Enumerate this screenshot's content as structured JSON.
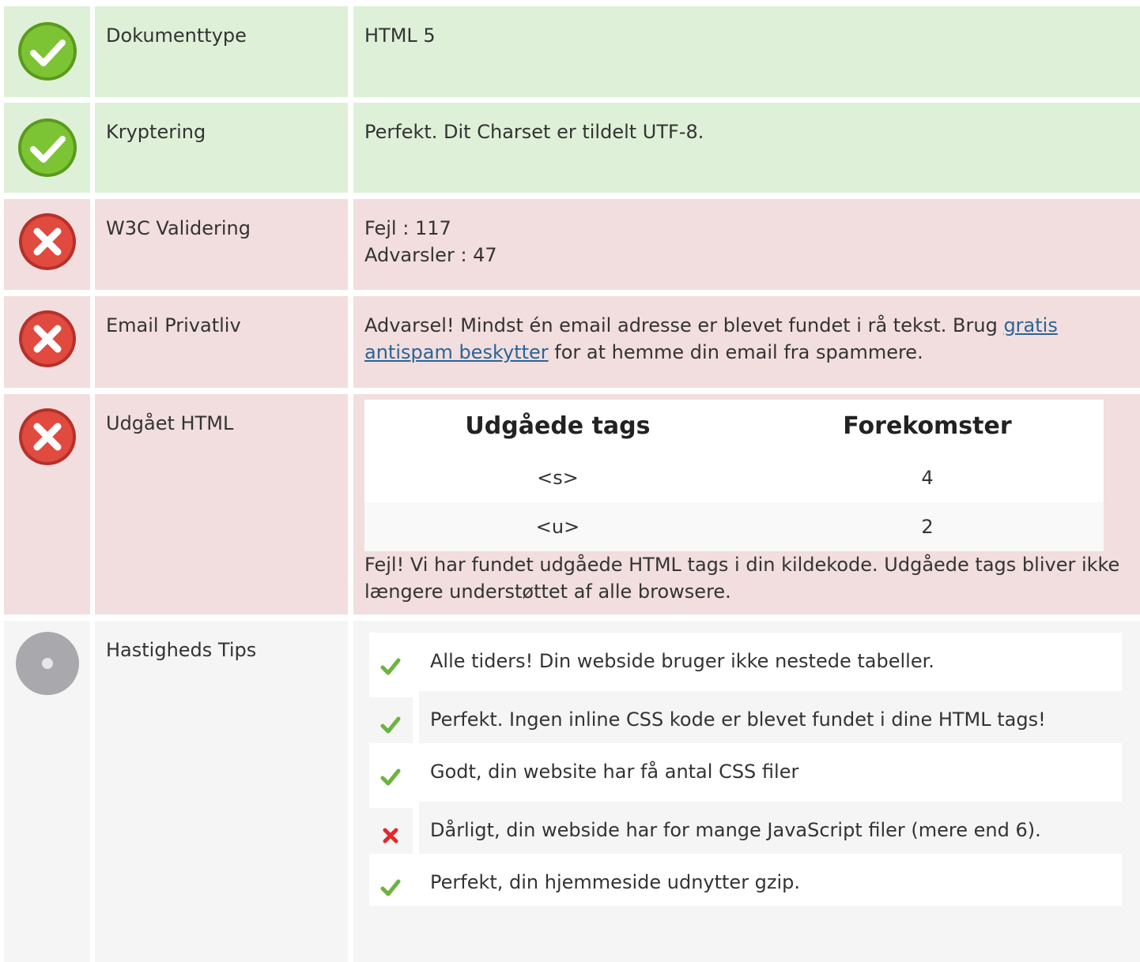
{
  "colors": {
    "ok_bg": "#dff0d8",
    "bad_bg": "#f2dede",
    "neutral_bg": "#f5f5f5",
    "ok_icon": "#6cb12a",
    "bad_icon": "#d9443a",
    "link": "#2a6496",
    "tip_pass": "#6db33f",
    "tip_fail": "#e2292a"
  },
  "rows": {
    "doctype": {
      "status": "pass",
      "icon": "check-circle-icon",
      "label": "Dokumenttype",
      "value": "HTML 5"
    },
    "encoding": {
      "status": "pass",
      "icon": "check-circle-icon",
      "label": "Kryptering",
      "value": "Perfekt. Dit Charset er tildelt UTF-8."
    },
    "w3c": {
      "status": "fail",
      "icon": "cross-circle-icon",
      "label": "W3C Validering",
      "errors_line": "Fejl : 117",
      "warnings_line": "Advarsler : 47"
    },
    "email": {
      "status": "fail",
      "icon": "cross-circle-icon",
      "label": "Email Privatliv",
      "text_before": "Advarsel! Mindst én email adresse er blevet fundet i rå tekst. Brug ",
      "link_text": "gratis antispam beskytter",
      "text_after": " for at hemme din email fra spammere."
    },
    "deprecated": {
      "status": "fail",
      "icon": "cross-circle-icon",
      "label": "Udgået HTML",
      "table_headers": [
        "Udgåede tags",
        "Forekomster"
      ],
      "table_rows": [
        {
          "tag": "<s>",
          "count": "4"
        },
        {
          "tag": "<u>",
          "count": "2"
        }
      ],
      "note": "Fejl! Vi har fundet udgåede HTML tags i din kildekode. Udgåede tags bliver ikke længere understøttet af alle browsere."
    },
    "speed": {
      "status": "info",
      "icon": "neutral-circle-icon",
      "label": "Hastigheds Tips",
      "tips": [
        {
          "result": "pass",
          "icon": "checkmark-icon",
          "text": "Alle tiders! Din webside bruger ikke nestede tabeller."
        },
        {
          "result": "pass",
          "icon": "checkmark-icon",
          "text": "Perfekt. Ingen inline CSS kode er blevet fundet i dine HTML tags!"
        },
        {
          "result": "pass",
          "icon": "checkmark-icon",
          "text": "Godt, din website har få antal CSS filer"
        },
        {
          "result": "fail",
          "icon": "x-mark-icon",
          "text": "Dårligt, din webside har for mange JavaScript filer (mere end 6)."
        },
        {
          "result": "pass",
          "icon": "checkmark-icon",
          "text": "Perfekt, din hjemmeside udnytter gzip."
        }
      ]
    }
  }
}
